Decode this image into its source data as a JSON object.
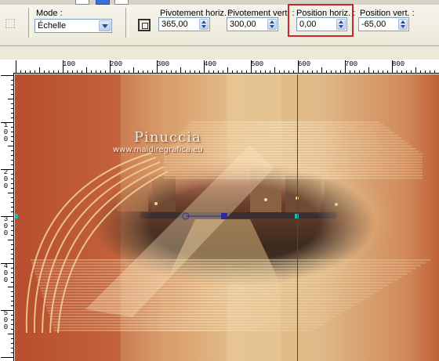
{
  "toolbar": {
    "mode": {
      "label": "Mode :",
      "value": "Échelle"
    },
    "pivot_h": {
      "label": "Pivotement horiz. :",
      "value": "365,00"
    },
    "pivot_v": {
      "label": "Pivotement vert. :",
      "value": "300,00"
    },
    "pos_h": {
      "label": "Position horiz. :",
      "value": "0,00"
    },
    "pos_v": {
      "label": "Position vert. :",
      "value": "-65,00"
    }
  },
  "ruler": {
    "horizontal": [
      "100",
      "200",
      "300",
      "400",
      "500",
      "600",
      "700",
      "800"
    ],
    "vertical": [
      [
        "1",
        "0",
        "0"
      ],
      [
        "2",
        "0",
        "0"
      ],
      [
        "3",
        "0",
        "0"
      ],
      [
        "4",
        "0",
        "0"
      ],
      [
        "5",
        "0",
        "0"
      ]
    ]
  },
  "canvas": {
    "watermark_name": "Pinuccia",
    "watermark_url": "www.maidiregrafica.eu"
  },
  "colors": {
    "highlight": "#c8262c",
    "accent": "#3c6fd8"
  }
}
